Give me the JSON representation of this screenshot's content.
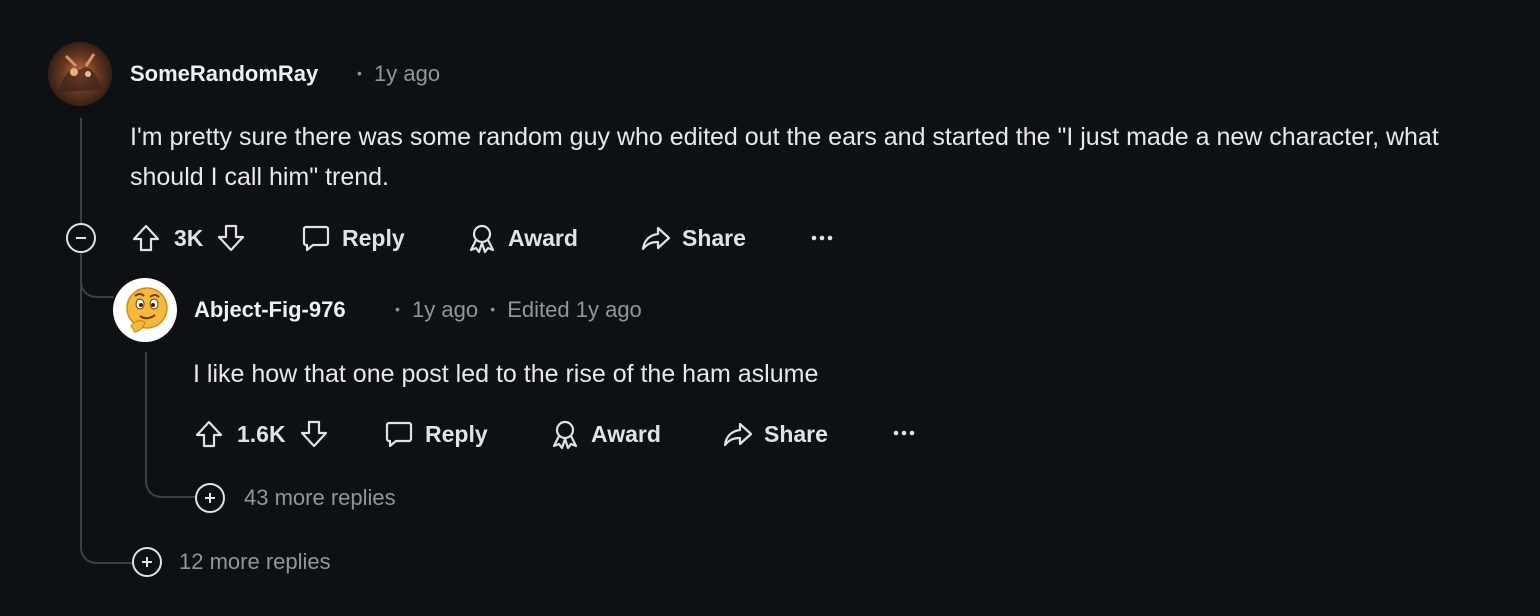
{
  "comment": {
    "author": "SomeRandomRay",
    "time": "1y ago",
    "body": "I'm pretty sure there was some random guy who edited out the ears and started the \"I just made a new character, what should I call him\" trend.",
    "votes": "3K",
    "reply_label": "Reply",
    "award_label": "Award",
    "share_label": "Share",
    "more_replies": "12 more replies"
  },
  "reply": {
    "author": "Abject-Fig-976",
    "time": "1y ago",
    "edited": "Edited 1y ago",
    "body": "I like how that one post led to the rise of the ham aslume",
    "votes": "1.6K",
    "reply_label": "Reply",
    "award_label": "Award",
    "share_label": "Share",
    "more_replies": "43 more replies"
  },
  "separator": "•",
  "colors": {
    "background": "#0e1113",
    "text": "#e6e9ec",
    "meta": "#8e979d",
    "thread_line": "#3a4045"
  }
}
